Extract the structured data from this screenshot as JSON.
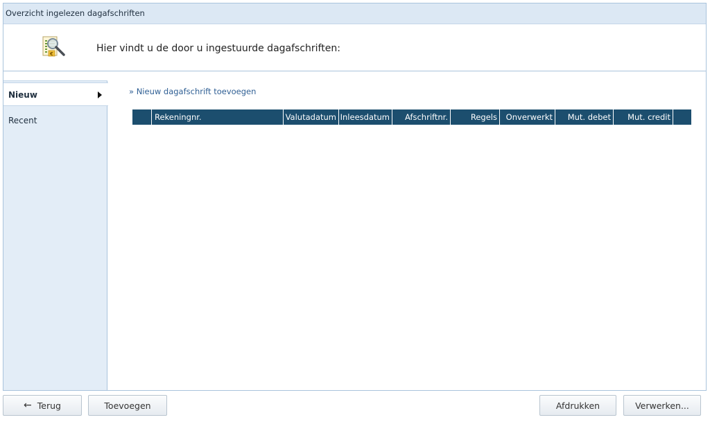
{
  "window": {
    "title": "Overzicht ingelezen dagafschriften"
  },
  "header": {
    "text": "Hier vindt u de door u ingestuurde dagafschriften:",
    "icon": "document-search-euro-icon"
  },
  "sidebar": {
    "items": [
      {
        "label": "Nieuw",
        "active": true
      },
      {
        "label": "Recent",
        "active": false
      }
    ]
  },
  "main": {
    "add_link": "» Nieuw dagafschrift toevoegen",
    "columns": [
      "",
      "Rekeningnr.",
      "Valutadatum",
      "Inleesdatum",
      "Afschriftnr.",
      "Regels",
      "Onverwerkt",
      "Mut. debet",
      "Mut. credit",
      ""
    ]
  },
  "footer": {
    "back_label": "Terug",
    "back_icon": "arrow-left-icon",
    "add_label": "Toevoegen",
    "print_label": "Afdrukken",
    "process_label": "Verwerken..."
  },
  "colors": {
    "grid_header": "#1c4e6e",
    "title_bar": "#dce8f4",
    "sidebar": "#e3edf7",
    "link": "#2f5f94"
  }
}
